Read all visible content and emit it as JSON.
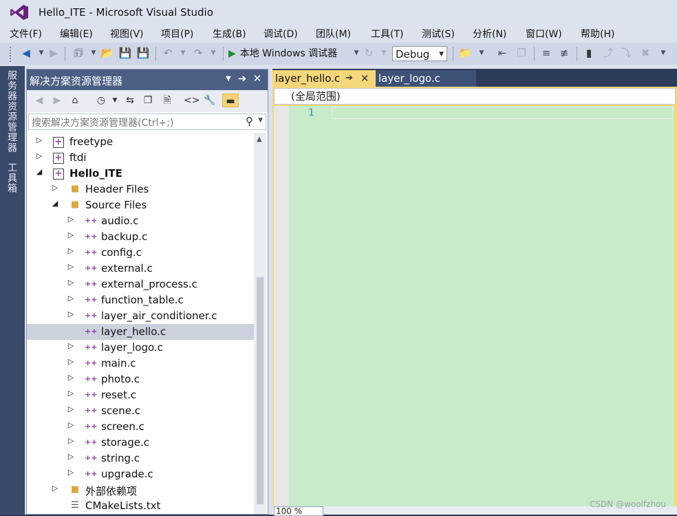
{
  "window": {
    "title": "Hello_ITE - Microsoft Visual Studio"
  },
  "menu": [
    "文件(F)",
    "编辑(E)",
    "视图(V)",
    "项目(P)",
    "生成(B)",
    "调试(D)",
    "团队(M)",
    "工具(T)",
    "测试(S)",
    "分析(N)",
    "窗口(W)",
    "帮助(H)"
  ],
  "toolbar": {
    "run_label": "本地 Windows 调试器",
    "config": "Debug"
  },
  "side_tabs": [
    "服务器资源管理器",
    "工具箱"
  ],
  "solution_explorer": {
    "title": "解决方案资源管理器",
    "search_placeholder": "搜索解决方案资源管理器(Ctrl+;)",
    "items": [
      {
        "label": "freetype",
        "type": "project",
        "expander": "collapsed",
        "level": 0
      },
      {
        "label": "ftdi",
        "type": "project",
        "expander": "collapsed",
        "level": 0
      },
      {
        "label": "Hello_ITE",
        "type": "project",
        "expander": "expanded",
        "level": 0,
        "bold": true
      },
      {
        "label": "Header Files",
        "type": "folder",
        "expander": "collapsed",
        "level": 1
      },
      {
        "label": "Source Files",
        "type": "folder",
        "expander": "expanded",
        "level": 1
      },
      {
        "label": "audio.c",
        "type": "file",
        "expander": "collapsed",
        "level": 2
      },
      {
        "label": "backup.c",
        "type": "file",
        "expander": "collapsed",
        "level": 2
      },
      {
        "label": "config.c",
        "type": "file",
        "expander": "collapsed",
        "level": 2
      },
      {
        "label": "external.c",
        "type": "file",
        "expander": "collapsed",
        "level": 2
      },
      {
        "label": "external_process.c",
        "type": "file",
        "expander": "collapsed",
        "level": 2
      },
      {
        "label": "function_table.c",
        "type": "file",
        "expander": "collapsed",
        "level": 2
      },
      {
        "label": "layer_air_conditioner.c",
        "type": "file",
        "expander": "collapsed",
        "level": 2
      },
      {
        "label": "layer_hello.c",
        "type": "file",
        "expander": "none",
        "level": 2,
        "selected": true
      },
      {
        "label": "layer_logo.c",
        "type": "file",
        "expander": "collapsed",
        "level": 2
      },
      {
        "label": "main.c",
        "type": "file",
        "expander": "collapsed",
        "level": 2
      },
      {
        "label": "photo.c",
        "type": "file",
        "expander": "collapsed",
        "level": 2
      },
      {
        "label": "reset.c",
        "type": "file",
        "expander": "collapsed",
        "level": 2
      },
      {
        "label": "scene.c",
        "type": "file",
        "expander": "collapsed",
        "level": 2
      },
      {
        "label": "screen.c",
        "type": "file",
        "expander": "collapsed",
        "level": 2
      },
      {
        "label": "storage.c",
        "type": "file",
        "expander": "collapsed",
        "level": 2
      },
      {
        "label": "string.c",
        "type": "file",
        "expander": "collapsed",
        "level": 2
      },
      {
        "label": "upgrade.c",
        "type": "file",
        "expander": "collapsed",
        "level": 2
      },
      {
        "label": "外部依赖项",
        "type": "deps",
        "expander": "collapsed",
        "level": 1
      },
      {
        "label": "CMakeLists.txt",
        "type": "text",
        "expander": "none",
        "level": 1
      }
    ]
  },
  "editor": {
    "tabs": [
      {
        "label": "layer_hello.c",
        "active": true
      },
      {
        "label": "layer_logo.c",
        "active": false
      }
    ],
    "scope": "(全局范围)",
    "line_numbers": [
      "1"
    ],
    "zoom": "100 %"
  },
  "watermark": "CSDN @woolfzhou"
}
